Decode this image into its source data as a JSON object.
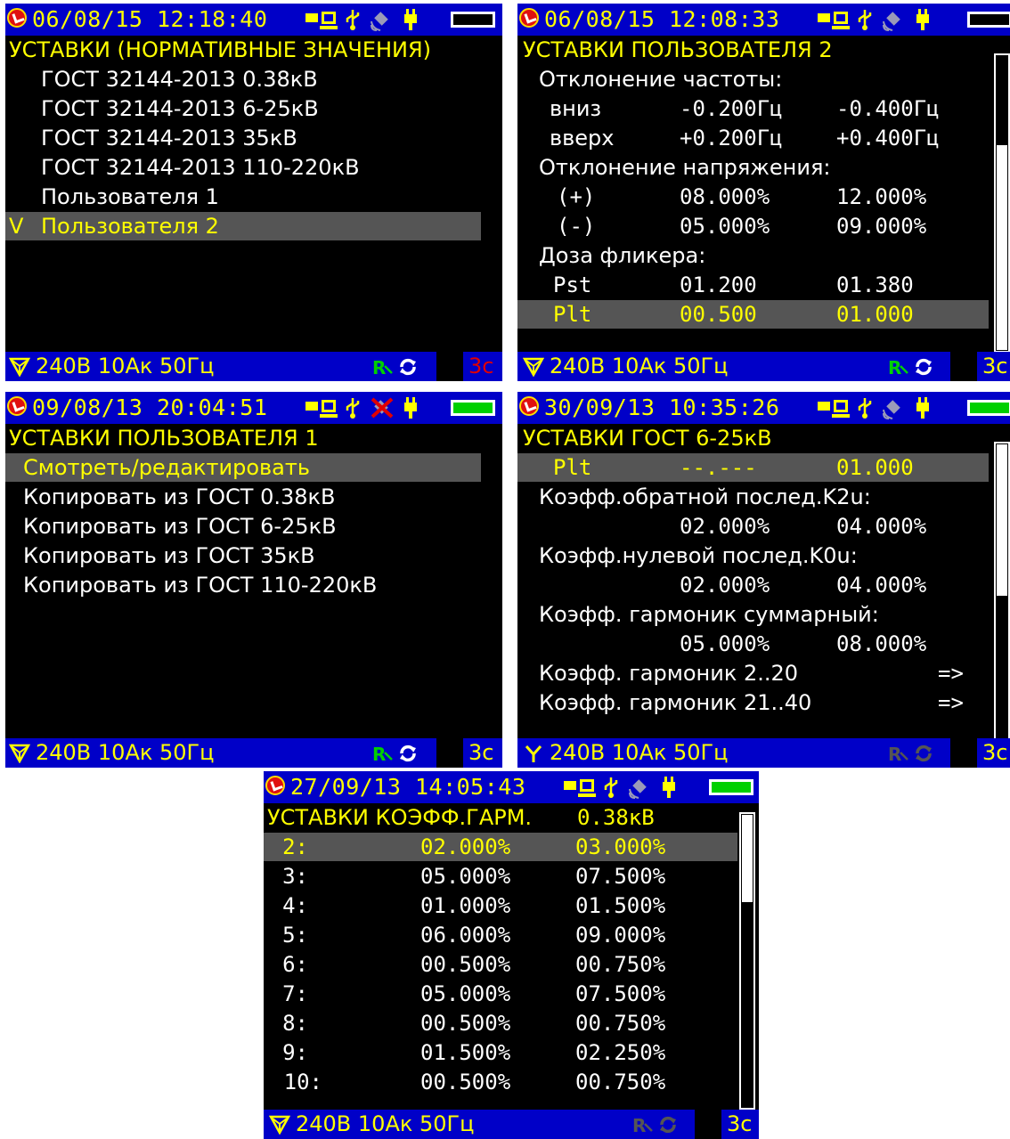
{
  "screens": [
    {
      "datetime": "06/08/15 12:18:40",
      "title": "УСТАВКИ (НОРМАТИВНЫЕ ЗНАЧЕНИЯ)",
      "items": [
        {
          "label": "ГОСТ 32144-2013 0.38кВ"
        },
        {
          "label": "ГОСТ 32144-2013 6-25кВ"
        },
        {
          "label": "ГОСТ 32144-2013 35кВ"
        },
        {
          "label": "ГОСТ 32144-2013 110-220кВ"
        },
        {
          "label": "Пользователя 1"
        },
        {
          "label": "Пользователя 2",
          "mark": "V"
        }
      ],
      "status": {
        "text": "240В 10Ак 50Гц",
        "time": "3с"
      }
    },
    {
      "datetime": "06/08/15 12:08:33",
      "title": "УСТАВКИ ПОЛЬЗОВАТЕЛЯ 2",
      "rows": [
        {
          "label": "Отклонение частоты:"
        },
        {
          "label": "вниз",
          "v1": "-0.200Гц",
          "v2": "-0.400Гц"
        },
        {
          "label": "вверх",
          "v1": "+0.200Гц",
          "v2": "+0.400Гц"
        },
        {
          "label": "Отклонение напряжения:"
        },
        {
          "label": "(+)",
          "v1": "08.000%",
          "v2": "12.000%"
        },
        {
          "label": "(-)",
          "v1": "05.000%",
          "v2": "09.000%"
        },
        {
          "label": "Доза фликера:"
        },
        {
          "label": "Pst",
          "v1": "01.200",
          "v2": "01.380"
        },
        {
          "label": "Plt",
          "v1": "00.500",
          "v2": "01.000"
        }
      ],
      "status": {
        "text": "240В 10Ак 50Гц",
        "time": "3с"
      }
    },
    {
      "datetime": "09/08/13 20:04:51",
      "title": "УСТАВКИ ПОЛЬЗОВАТЕЛЯ 1",
      "items": [
        {
          "label": "Смотреть/редактировать"
        },
        {
          "label": "Копировать из ГОСТ 0.38кВ"
        },
        {
          "label": "Копировать из ГОСТ 6-25кВ"
        },
        {
          "label": "Копировать из ГОСТ 35кВ"
        },
        {
          "label": "Копировать из ГОСТ 110-220кВ"
        }
      ],
      "status": {
        "text": "240В 10Ак 50Гц",
        "time": "3с"
      }
    },
    {
      "datetime": "30/09/13 10:35:26",
      "title": "УСТАВКИ ГОСТ 6-25кВ",
      "rows": [
        {
          "label": "Plt",
          "v1": "--.---",
          "v2": "01.000"
        },
        {
          "label": "Коэфф.обратной послед.K2u:"
        },
        {
          "v1": "02.000%",
          "v2": "04.000%"
        },
        {
          "label": "Коэфф.нулевой послед.K0u:"
        },
        {
          "v1": "02.000%",
          "v2": "04.000%"
        },
        {
          "label": "Коэфф. гармоник суммарный:"
        },
        {
          "v1": "05.000%",
          "v2": "08.000%"
        },
        {
          "label": "Коэфф. гармоник 2..20",
          "arrow": "=>"
        },
        {
          "label": "Коэфф. гармоник 21..40",
          "arrow": "=>"
        }
      ],
      "status": {
        "text": "240В 10Ак 50Гц",
        "time": "3с"
      }
    },
    {
      "datetime": "27/09/13 14:05:43",
      "title": "УСТАВКИ КОЭФФ.ГАРМ.",
      "title_value": "0.38кВ",
      "rows": [
        {
          "n": "2:",
          "v1": "02.000%",
          "v2": "03.000%"
        },
        {
          "n": "3:",
          "v1": "05.000%",
          "v2": "07.500%"
        },
        {
          "n": "4:",
          "v1": "01.000%",
          "v2": "01.500%"
        },
        {
          "n": "5:",
          "v1": "06.000%",
          "v2": "09.000%"
        },
        {
          "n": "6:",
          "v1": "00.500%",
          "v2": "00.750%"
        },
        {
          "n": "7:",
          "v1": "05.000%",
          "v2": "07.500%"
        },
        {
          "n": "8:",
          "v1": "00.500%",
          "v2": "00.750%"
        },
        {
          "n": "9:",
          "v1": "01.500%",
          "v2": "02.250%"
        },
        {
          "n": "10:",
          "v1": "00.500%",
          "v2": "00.750%"
        }
      ],
      "status": {
        "text": "240В 10Ак 50Гц",
        "time": "3с"
      }
    }
  ]
}
